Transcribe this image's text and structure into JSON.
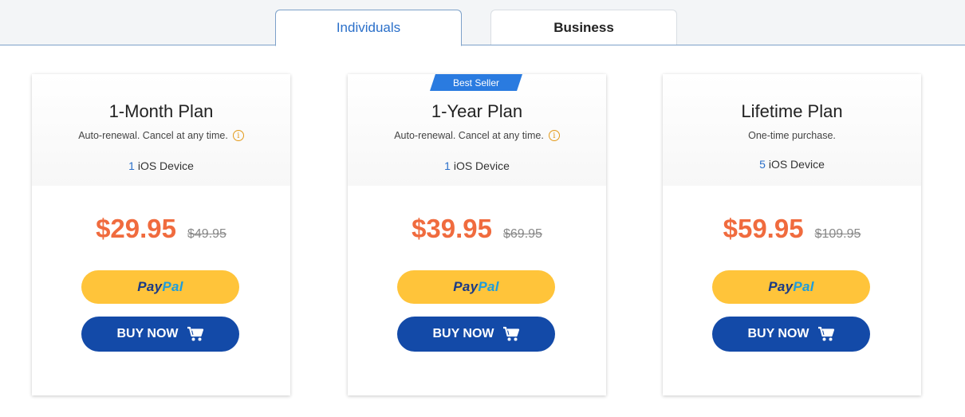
{
  "tabs": [
    {
      "label": "Individuals",
      "active": true
    },
    {
      "label": "Business",
      "active": false
    }
  ],
  "plans": [
    {
      "title": "1-Month Plan",
      "subtitle": "Auto-renewal. Cancel at any time.",
      "has_info": true,
      "device_count": "1",
      "device_label": "iOS Device",
      "price": "$29.95",
      "old_price": "$49.95",
      "paypal_a": "Pay",
      "paypal_b": "Pal",
      "buy_label": "BUY NOW",
      "badge": ""
    },
    {
      "title": "1-Year Plan",
      "subtitle": "Auto-renewal. Cancel at any time.",
      "has_info": true,
      "device_count": "1",
      "device_label": "iOS Device",
      "price": "$39.95",
      "old_price": "$69.95",
      "paypal_a": "Pay",
      "paypal_b": "Pal",
      "buy_label": "BUY NOW",
      "badge": "Best Seller"
    },
    {
      "title": "Lifetime Plan",
      "subtitle": "One-time purchase.",
      "has_info": false,
      "device_count": "5",
      "device_label": "iOS Device",
      "price": "$59.95",
      "old_price": "$109.95",
      "paypal_a": "Pay",
      "paypal_b": "Pal",
      "buy_label": "BUY NOW",
      "badge": ""
    }
  ],
  "colors": {
    "accent_blue": "#2a6fc9",
    "price_orange": "#f06b3e",
    "paypal_yellow": "#ffc43a",
    "buy_blue": "#134aa8",
    "badge_blue": "#2a7be0"
  },
  "icons": {
    "info": "info-circle-icon",
    "cart": "shopping-cart-icon"
  }
}
